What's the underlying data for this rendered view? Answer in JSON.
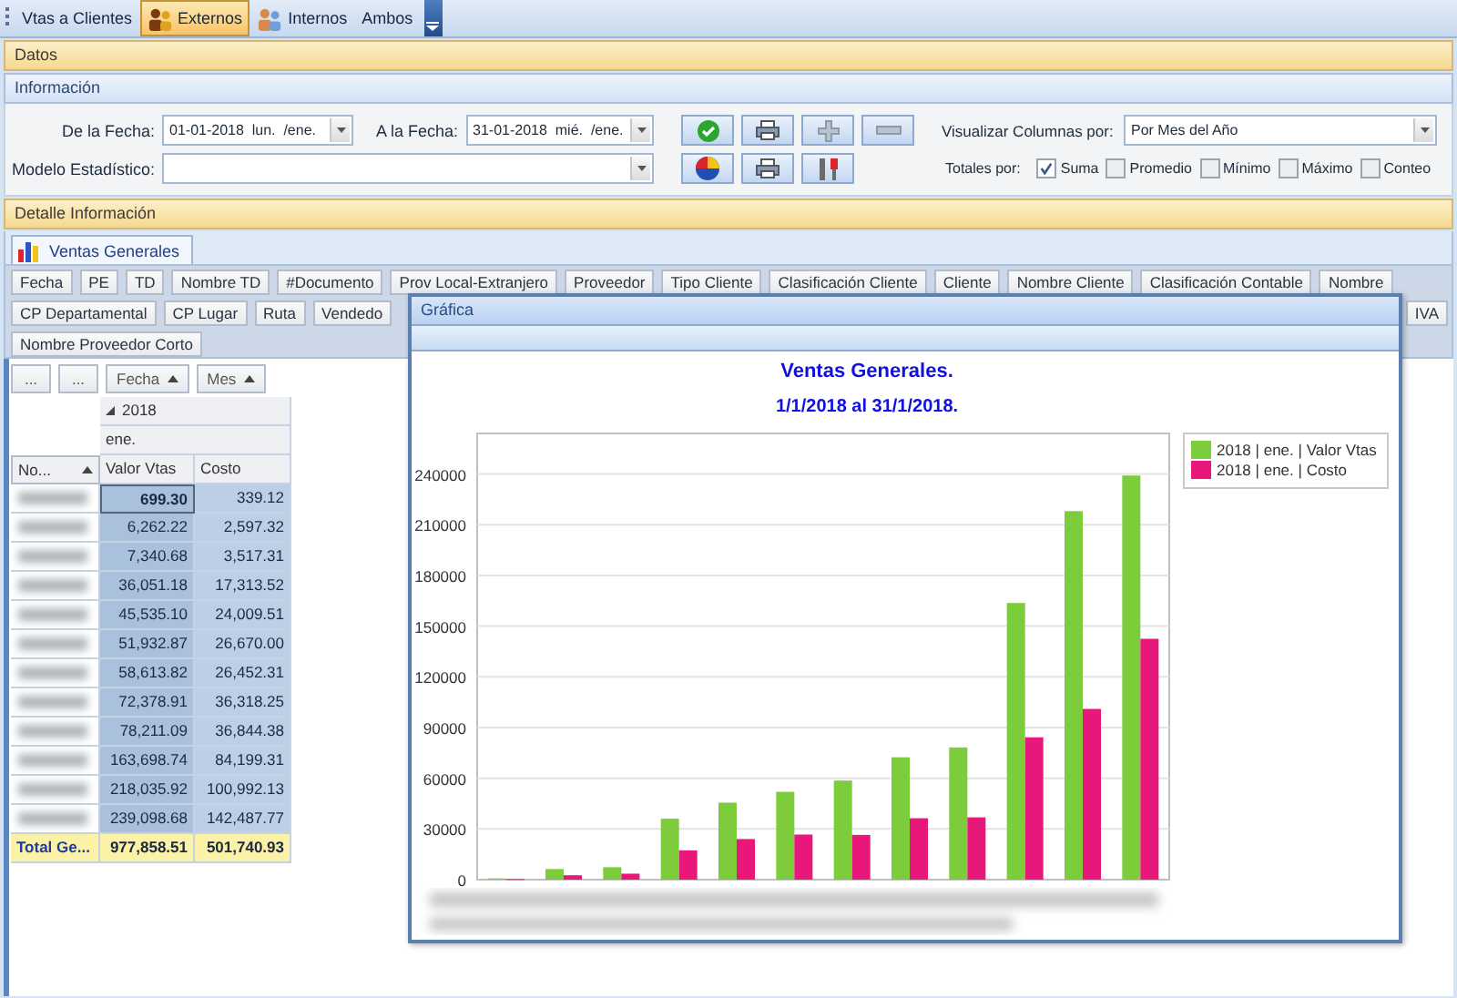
{
  "toolbar": {
    "items": [
      {
        "label": "Vtas a Clientes",
        "selected": false,
        "kind": "text"
      },
      {
        "label": "Externos",
        "selected": true,
        "kind": "icon"
      },
      {
        "label": "Internos",
        "selected": false,
        "kind": "icon"
      },
      {
        "label": "Ambos",
        "selected": false,
        "kind": "text"
      }
    ]
  },
  "datos_bar": {
    "title": "Datos"
  },
  "informacion": {
    "title": "Información",
    "de_la_fecha": {
      "label": "De la Fecha:",
      "value": "01-01-2018  lun.  /ene."
    },
    "a_la_fecha": {
      "label": "A la Fecha:",
      "value": "31-01-2018  mié.  /ene."
    },
    "modelo_estadistico": {
      "label": "Modelo Estadístico:"
    },
    "visualizar_columnas": {
      "label": "Visualizar Columnas por:",
      "value": "Por Mes del Año"
    },
    "totales": {
      "label": "Totales por:",
      "options": [
        {
          "label": "Suma",
          "checked": true
        },
        {
          "label": "Promedio",
          "checked": false
        },
        {
          "label": "Mínimo",
          "checked": false
        },
        {
          "label": "Máximo",
          "checked": false
        },
        {
          "label": "Conteo",
          "checked": false
        }
      ]
    }
  },
  "detalle_bar": {
    "title": "Detalle Información"
  },
  "tabs": [
    {
      "label": "Ventas Generales",
      "selected": true
    }
  ],
  "field_rows": [
    [
      "Fecha",
      "PE",
      "TD",
      "Nombre TD",
      "#Documento",
      "Prov Local-Extranjero",
      "Proveedor",
      "Tipo Cliente",
      "Clasificación Cliente",
      "Cliente",
      "Nombre Cliente",
      "Clasificación Contable",
      "Nombre"
    ],
    [
      "CP Departamental",
      "CP Lugar",
      "Ruta",
      "Vendedo",
      "IVA"
    ],
    [
      "Nombre Proveedor Corto"
    ]
  ],
  "pivot": {
    "filter_buttons": [
      "...",
      "..."
    ],
    "column_fields": [
      "Fecha",
      "Mes"
    ],
    "year": "2018",
    "month": "ene.",
    "row_field": "No...",
    "data_fields": [
      "Valor Vtas",
      "Costo"
    ],
    "rows": [
      {
        "valor": "699.30",
        "costo": "339.12",
        "selected": true
      },
      {
        "valor": "6,262.22",
        "costo": "2,597.32",
        "selected": false
      },
      {
        "valor": "7,340.68",
        "costo": "3,517.31",
        "selected": false
      },
      {
        "valor": "36,051.18",
        "costo": "17,313.52",
        "selected": false
      },
      {
        "valor": "45,535.10",
        "costo": "24,009.51",
        "selected": false
      },
      {
        "valor": "51,932.87",
        "costo": "26,670.00",
        "selected": false
      },
      {
        "valor": "58,613.82",
        "costo": "26,452.31",
        "selected": false
      },
      {
        "valor": "72,378.91",
        "costo": "36,318.25",
        "selected": false
      },
      {
        "valor": "78,211.09",
        "costo": "36,844.38",
        "selected": false
      },
      {
        "valor": "163,698.74",
        "costo": "84,199.31",
        "selected": false
      },
      {
        "valor": "218,035.92",
        "costo": "100,992.13",
        "selected": false
      },
      {
        "valor": "239,098.68",
        "costo": "142,487.77",
        "selected": false
      }
    ],
    "total": {
      "label": "Total Ge...",
      "valor": "977,858.51",
      "costo": "501,740.93"
    }
  },
  "chart_window": {
    "title": "Gráfica",
    "subtitle": "1/1/2018 al 31/1/2018.",
    "chart_data": {
      "type": "bar",
      "title": "Ventas Generales.",
      "grid": true,
      "legend": "right",
      "ylim": [
        0,
        264000
      ],
      "yticks": [
        0,
        30000,
        60000,
        90000,
        120000,
        150000,
        180000,
        210000,
        240000
      ],
      "series": [
        {
          "name": "2018 | ene. | Valor Vtas",
          "color": "#7dcc3c",
          "values": [
            699.3,
            6262.22,
            7340.68,
            36051.18,
            45535.1,
            51932.87,
            58613.82,
            72378.91,
            78211.09,
            163698.74,
            218035.92,
            239098.68
          ]
        },
        {
          "name": "2018 | ene. | Costo",
          "color": "#e8177a",
          "values": [
            339.12,
            2597.32,
            3517.31,
            17313.52,
            24009.51,
            26670.0,
            26452.31,
            36318.25,
            36844.38,
            84199.31,
            100992.13,
            142487.77
          ]
        }
      ]
    }
  }
}
